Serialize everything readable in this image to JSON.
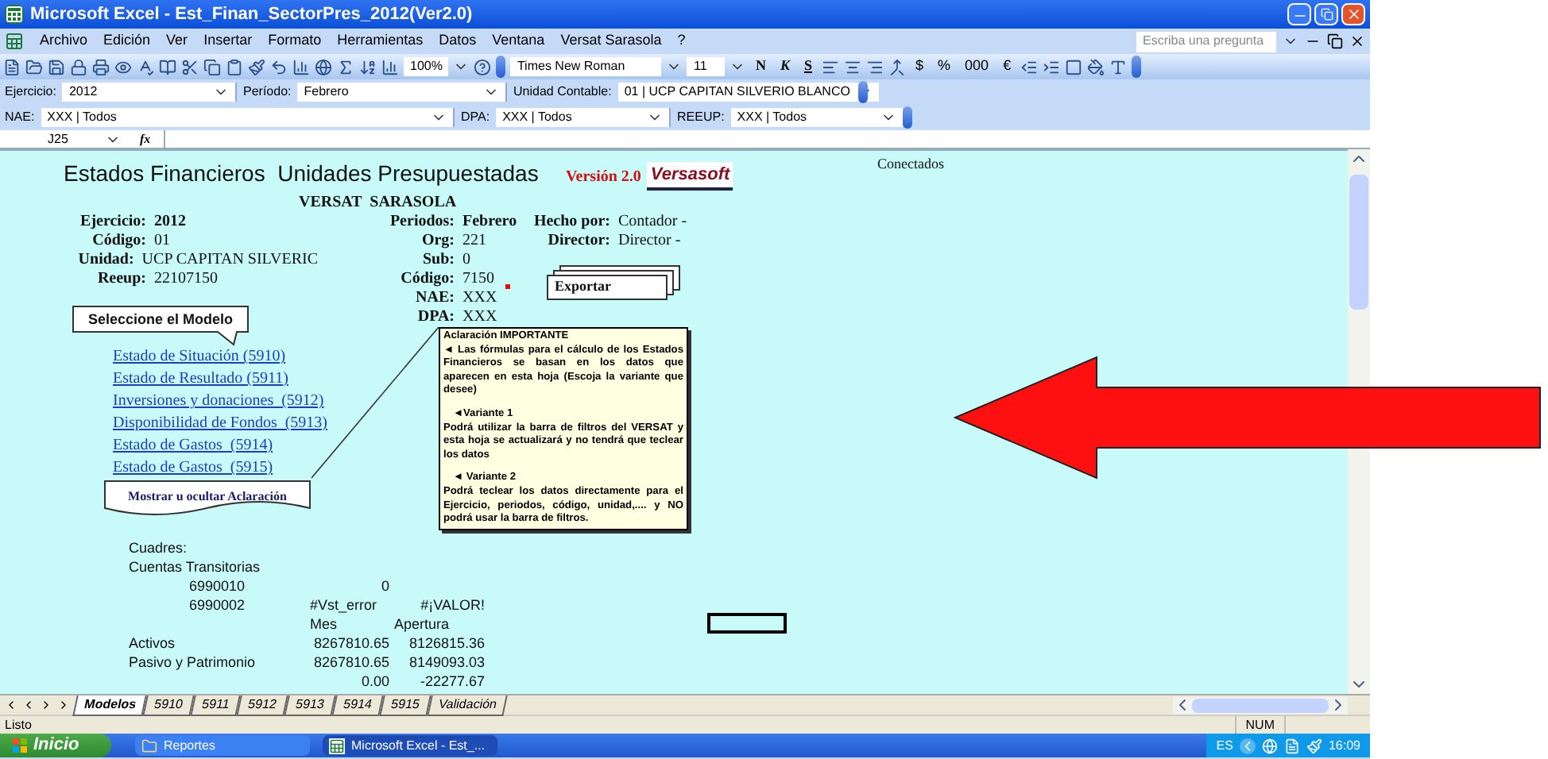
{
  "window": {
    "title": "Microsoft Excel - Est_Finan_SectorPres_2012(Ver2.0)"
  },
  "menu": {
    "items": [
      "Archivo",
      "Edición",
      "Ver",
      "Insertar",
      "Formato",
      "Herramientas",
      "Datos",
      "Ventana",
      "Versat Sarasola",
      "?"
    ],
    "help_placeholder": "Escriba una pregunta"
  },
  "toolbar": {
    "zoom": "100%",
    "font": "Times New Roman",
    "size": "11",
    "format_buttons": [
      "N",
      "K",
      "S"
    ],
    "number_buttons": [
      "$",
      "%",
      "000",
      "€"
    ]
  },
  "filters": [
    [
      {
        "label": "Ejercicio:",
        "value": "2012"
      },
      {
        "label": "Período:",
        "value": "Febrero"
      },
      {
        "label": "Unidad Contable:",
        "value": "01 | UCP CAPITAN SILVERIO BLANCO"
      }
    ],
    [
      {
        "label": "NAE:",
        "value": "XXX | Todos"
      },
      {
        "label": "DPA:",
        "value": "XXX | Todos"
      },
      {
        "label": "REEUP:",
        "value": "XXX | Todos"
      }
    ]
  ],
  "formula_bar": {
    "cell": "J25",
    "function_label": "fx"
  },
  "sheet": {
    "connection": "Conectados",
    "title": "Estados Financieros  Unidades Presupuestadas",
    "version": "Versión 2.0",
    "logo": "Versasoft",
    "subtitle": "VERSAT  SARASOLA",
    "info_left": [
      {
        "label": "Ejercicio:",
        "value": "2012",
        "bold": true
      },
      {
        "label": "Código:",
        "value": "01",
        "bold": false
      },
      {
        "label": "Unidad:",
        "value": "UCP CAPITAN SILVERIC",
        "bold": false
      },
      {
        "label": "Reeup:",
        "value": "22107150",
        "bold": false
      }
    ],
    "info_mid": [
      {
        "label": "Periodos:",
        "value": "Febrero",
        "bold": true
      },
      {
        "label": "Org:",
        "value": "221",
        "bold": false
      },
      {
        "label": "Sub:",
        "value": "0",
        "bold": false
      },
      {
        "label": "Código:",
        "value": "7150",
        "bold": false
      },
      {
        "label": "NAE:",
        "value": "XXX",
        "bold": false
      },
      {
        "label": "DPA:",
        "value": "XXX",
        "bold": false
      }
    ],
    "info_right": [
      {
        "label": "Hecho por:",
        "value": "Contador -",
        "bold": false
      },
      {
        "label": "Director:",
        "value": "Director -",
        "bold": false
      }
    ],
    "model_callout": "Seleccione el Modelo",
    "export_button": "Exportar",
    "models": [
      "Estado de Situación (5910)",
      "Estado de Resultado (5911)",
      "Inversiones y donaciones  (5912)",
      "Disponibilidad de Fondos  (5913)",
      "Estado de Gastos  (5914)",
      "Estado de Gastos  (5915)"
    ],
    "toggle_button": "Mostrar u ocultar Aclaración",
    "note": {
      "title": "Aclaración IMPORTANTE",
      "paragraphs": [
        {
          "kind": "body",
          "text": "◄ Las fórmulas para el cálculo de los Estados Financieros se basan en los datos que aparecen en esta hoja (Escoja la variante que desee)"
        },
        {
          "kind": "heading",
          "text": "◄Variante 1"
        },
        {
          "kind": "body",
          "text": "Podrá utilizar la barra de filtros del VERSAT y esta hoja se actualizará y no tendrá que teclear los datos"
        },
        {
          "kind": "heading",
          "text": "◄ Variante 2"
        },
        {
          "kind": "body",
          "text": "Podrá teclear los datos directamente para el Ejercicio, periodos, código, unidad,.... y NO podrá usar la barra de filtros."
        }
      ]
    },
    "cuadres": {
      "label": "Cuadres:",
      "sublabel": "Cuentas Transitorias",
      "rows": [
        {
          "kind": "account",
          "label": "6990010",
          "mes": "0"
        },
        {
          "kind": "account",
          "label": "6990002",
          "mes": "#Vst_error",
          "apertura": "#¡VALOR!"
        },
        {
          "kind": "header",
          "mes": "Mes",
          "apertura": "Apertura"
        },
        {
          "kind": "total",
          "label": "Activos",
          "mes": "8267810.65",
          "apertura": "8126815.36"
        },
        {
          "kind": "total",
          "label": "Pasivo y Patrimonio",
          "mes": "8267810.65",
          "apertura": "8149093.03"
        },
        {
          "kind": "total",
          "mes": "0.00",
          "apertura": "-22277.67"
        }
      ]
    }
  },
  "sheet_tabs": [
    {
      "label": "Modelos",
      "selected": true
    },
    {
      "label": "5910",
      "selected": false
    },
    {
      "label": "5911",
      "selected": false
    },
    {
      "label": "5912",
      "selected": false
    },
    {
      "label": "5913",
      "selected": false
    },
    {
      "label": "5914",
      "selected": false
    },
    {
      "label": "5915",
      "selected": false
    },
    {
      "label": "Validación",
      "selected": false
    }
  ],
  "status_bar": {
    "text": "Listo",
    "indicator": "NUM"
  },
  "taskbar": {
    "start": "Inicio",
    "tasks": [
      {
        "label": "Reportes",
        "kind": "folder",
        "selected": false
      },
      {
        "label": "Microsoft Excel - Est_...",
        "kind": "excel",
        "selected": true
      }
    ],
    "language": "ES",
    "time": "16:09"
  }
}
